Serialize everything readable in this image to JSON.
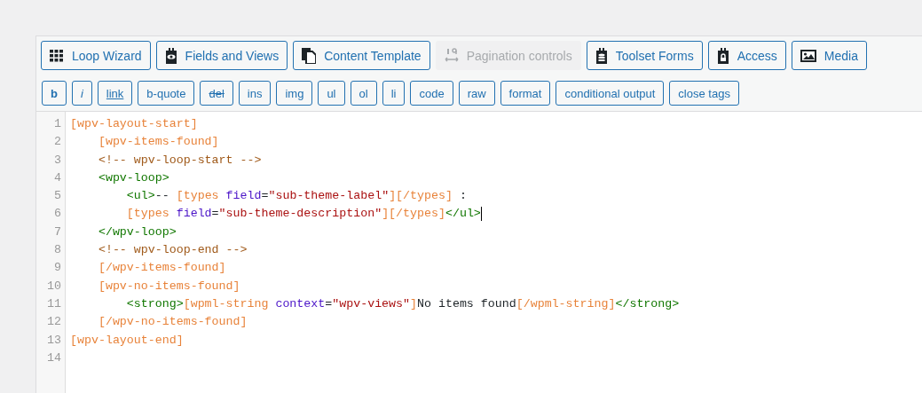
{
  "toolbar": [
    {
      "label": "Loop Wizard",
      "disabled": false
    },
    {
      "label": "Fields and Views",
      "disabled": false
    },
    {
      "label": "Content Template",
      "disabled": false
    },
    {
      "label": "Pagination controls",
      "disabled": true
    },
    {
      "label": "Toolset Forms",
      "disabled": false
    },
    {
      "label": "Access",
      "disabled": false
    },
    {
      "label": "Media",
      "disabled": false
    }
  ],
  "quicktags": [
    {
      "label": "b",
      "kind": "bold"
    },
    {
      "label": "i",
      "kind": "italic"
    },
    {
      "label": "link",
      "kind": "underline"
    },
    {
      "label": "b-quote",
      "kind": "plain"
    },
    {
      "label": "del",
      "kind": "strike"
    },
    {
      "label": "ins",
      "kind": "plain"
    },
    {
      "label": "img",
      "kind": "plain"
    },
    {
      "label": "ul",
      "kind": "plain"
    },
    {
      "label": "ol",
      "kind": "plain"
    },
    {
      "label": "li",
      "kind": "plain"
    },
    {
      "label": "code",
      "kind": "plain"
    },
    {
      "label": "raw",
      "kind": "plain"
    },
    {
      "label": "format",
      "kind": "plain"
    },
    {
      "label": "conditional output",
      "kind": "plain"
    },
    {
      "label": "close tags",
      "kind": "plain"
    }
  ],
  "editor": {
    "lines": [
      {
        "number": "1",
        "cursor": false,
        "tokens": [
          {
            "kind": "shortcode",
            "text": "[wpv-layout-start]"
          }
        ]
      },
      {
        "number": "2",
        "cursor": false,
        "tokens": [
          {
            "kind": "shortcode",
            "text": "    [wpv-items-found]"
          }
        ]
      },
      {
        "number": "3",
        "cursor": false,
        "tokens": [
          {
            "kind": "comment",
            "text": "    <!-- wpv-loop-start -->"
          }
        ]
      },
      {
        "number": "4",
        "cursor": false,
        "tokens": [
          {
            "kind": "tag",
            "text": "    <wpv-loop>"
          }
        ]
      },
      {
        "number": "5",
        "cursor": false,
        "tokens": [
          {
            "kind": "tag",
            "text": "        <ul>"
          },
          {
            "kind": "text",
            "text": "-- "
          },
          {
            "kind": "shortcode",
            "text": "[types "
          },
          {
            "kind": "attr",
            "text": "field"
          },
          {
            "kind": "text",
            "text": "="
          },
          {
            "kind": "string",
            "text": "\"sub-theme-label\""
          },
          {
            "kind": "shortcode",
            "text": "][/types]"
          },
          {
            "kind": "text",
            "text": " :"
          }
        ]
      },
      {
        "number": "6",
        "cursor": true,
        "tokens": [
          {
            "kind": "shortcode",
            "text": "        [types "
          },
          {
            "kind": "attr",
            "text": "field"
          },
          {
            "kind": "text",
            "text": "="
          },
          {
            "kind": "string",
            "text": "\"sub-theme-description\""
          },
          {
            "kind": "shortcode",
            "text": "][/types]"
          },
          {
            "kind": "tag",
            "text": "</ul>"
          }
        ]
      },
      {
        "number": "7",
        "cursor": false,
        "tokens": [
          {
            "kind": "tag",
            "text": "    </wpv-loop>"
          }
        ]
      },
      {
        "number": "8",
        "cursor": false,
        "tokens": [
          {
            "kind": "comment",
            "text": "    <!-- wpv-loop-end -->"
          }
        ]
      },
      {
        "number": "9",
        "cursor": false,
        "tokens": [
          {
            "kind": "shortcode",
            "text": "    [/wpv-items-found]"
          }
        ]
      },
      {
        "number": "10",
        "cursor": false,
        "tokens": [
          {
            "kind": "shortcode",
            "text": "    [wpv-no-items-found]"
          }
        ]
      },
      {
        "number": "11",
        "cursor": false,
        "tokens": [
          {
            "kind": "tag",
            "text": "        <strong>"
          },
          {
            "kind": "shortcode",
            "text": "[wpml-string "
          },
          {
            "kind": "attr",
            "text": "context"
          },
          {
            "kind": "text",
            "text": "="
          },
          {
            "kind": "string",
            "text": "\"wpv-views\""
          },
          {
            "kind": "shortcode",
            "text": "]"
          },
          {
            "kind": "text",
            "text": "No items found"
          },
          {
            "kind": "shortcode",
            "text": "[/wpml-string]"
          },
          {
            "kind": "tag",
            "text": "</strong>"
          }
        ]
      },
      {
        "number": "12",
        "cursor": false,
        "tokens": [
          {
            "kind": "shortcode",
            "text": "    [/wpv-no-items-found]"
          }
        ]
      },
      {
        "number": "13",
        "cursor": false,
        "tokens": [
          {
            "kind": "shortcode",
            "text": "[wpv-layout-end]"
          }
        ]
      },
      {
        "number": "14",
        "cursor": false
      }
    ]
  }
}
